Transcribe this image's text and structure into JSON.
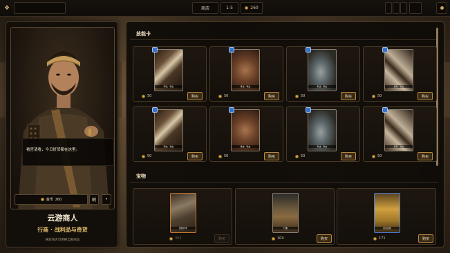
{
  "topbar": {
    "title": "商店",
    "level": "1-5",
    "gold": "260"
  },
  "merchant": {
    "speech": "看官请看，今日好货都在这里。",
    "gold_label": "金币",
    "gold_value": "260",
    "refresh_label": "刷",
    "more_label": "•",
    "name": "云游商人",
    "subtitle": "行商 · 战利品与奇货",
    "description": "刷新商店可更换全部商品"
  },
  "skill_section": {
    "title": "技能卡",
    "buy_label": "购买",
    "cards": [
      {
        "price": "50",
        "label": "刺击 · 攻击"
      },
      {
        "price": "50",
        "label": "重击 · 攻击"
      },
      {
        "price": "50",
        "label": "斩击 · 攻击"
      },
      {
        "price": "50",
        "label": "连斩 · 攻击"
      },
      {
        "price": "50",
        "label": "刺击 · 攻击"
      },
      {
        "price": "50",
        "label": "重击 · 攻击"
      },
      {
        "price": "50",
        "label": "斩击 · 攻击"
      },
      {
        "price": "50",
        "label": "连斩 · 攻击"
      }
    ]
  },
  "relic_section": {
    "title": "宝物",
    "buy_label": "购买",
    "relics": [
      {
        "price": "363",
        "label": "残破护甲",
        "affordable": false
      },
      {
        "price": "104",
        "label": "行囊",
        "affordable": true
      },
      {
        "price": "171",
        "label": "金色战旗",
        "affordable": true
      }
    ]
  },
  "colors": {
    "accent_gold": "#d6a84a",
    "panel_border": "#4a3a26",
    "subtitle": "#e3c06e",
    "gem_blue": "#3a72c8"
  }
}
